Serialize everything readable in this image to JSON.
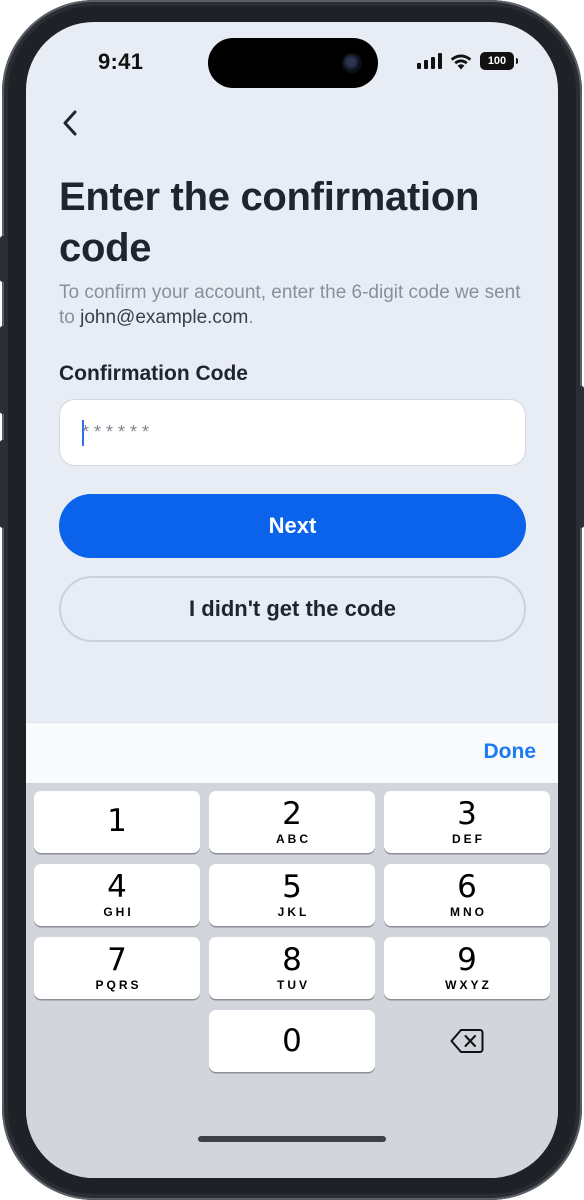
{
  "status_bar": {
    "time": "9:41",
    "battery": "100"
  },
  "header": {
    "back_icon": "chevron-left-icon",
    "title": "Enter the confirmation code",
    "subtitle_prefix": "To confirm your account, enter the 6-digit code we sent to ",
    "email": "john@example.com",
    "subtitle_suffix": "."
  },
  "form": {
    "label": "Confirmation Code",
    "value": "",
    "placeholder": "******"
  },
  "buttons": {
    "next": "Next",
    "resend": "I didn't get the code"
  },
  "keyboard": {
    "done": "Done",
    "keys": [
      {
        "num": "1",
        "letters": ""
      },
      {
        "num": "2",
        "letters": "ABC"
      },
      {
        "num": "3",
        "letters": "DEF"
      },
      {
        "num": "4",
        "letters": "GHI"
      },
      {
        "num": "5",
        "letters": "JKL"
      },
      {
        "num": "6",
        "letters": "MNO"
      },
      {
        "num": "7",
        "letters": "PQRS"
      },
      {
        "num": "8",
        "letters": "TUV"
      },
      {
        "num": "9",
        "letters": "WXYZ"
      },
      {
        "num": "0",
        "letters": ""
      }
    ],
    "delete_icon": "backspace-icon"
  },
  "colors": {
    "accent": "#0a63ea",
    "done": "#1a7cf0",
    "background": "#e8ecf4"
  }
}
